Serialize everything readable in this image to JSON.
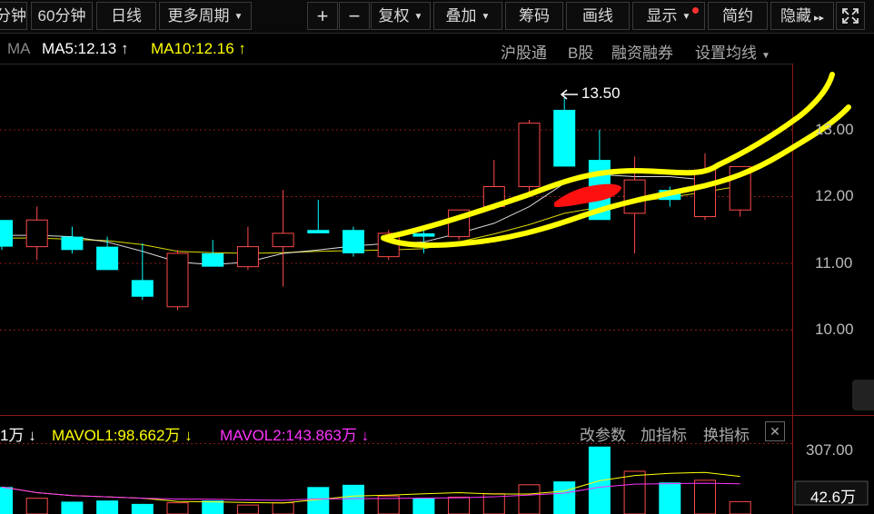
{
  "toolbar": {
    "left_items": [
      "分钟",
      "60分钟",
      "日线",
      "更多周期"
    ],
    "right_items": [
      "复权",
      "叠加",
      "筹码",
      "画线",
      "显示",
      "简约",
      "隐藏"
    ],
    "plus": "+",
    "minus": "−",
    "more_arrows": "▸▸"
  },
  "ma_bar": {
    "ma_label": "MA",
    "ma5": "MA5:12.13",
    "ma10": "MA10:12.16",
    "up_arrow": "↑",
    "links": [
      "沪股通",
      "B股",
      "融资融券",
      "设置均线"
    ]
  },
  "price_axis": [
    "13.00",
    "12.00",
    "11.00",
    "10.00"
  ],
  "max_annotation": "13.50",
  "vol_bar": {
    "vol_prefix": "1万",
    "mavol1": "MAVOL1:98.662万",
    "mavol2": "MAVOL2:143.863万",
    "down_arrow": "↓",
    "buttons": [
      "改参数",
      "加指标",
      "换指标"
    ],
    "close": "✕"
  },
  "vol_axis_top": "307.00",
  "vol_current": "42.6万",
  "colors": {
    "up": "#ff4a4a",
    "down": "#00ffff",
    "ma5": "#ffffff",
    "ma10": "#ffff00",
    "mavol2": "#ff33ff",
    "highlight": "#ffff00",
    "marker": "#ff0000"
  },
  "chart_data": {
    "type": "candlestick",
    "ylim": [
      9.0,
      14.0
    ],
    "candles": [
      {
        "o": 11.65,
        "h": 11.65,
        "l": 11.2,
        "c": 11.25
      },
      {
        "o": 11.25,
        "h": 11.85,
        "l": 11.05,
        "c": 11.65
      },
      {
        "o": 11.4,
        "h": 11.55,
        "l": 11.15,
        "c": 11.2
      },
      {
        "o": 11.25,
        "h": 11.4,
        "l": 10.9,
        "c": 10.9
      },
      {
        "o": 10.75,
        "h": 11.3,
        "l": 10.45,
        "c": 10.5
      },
      {
        "o": 10.35,
        "h": 11.2,
        "l": 10.3,
        "c": 11.15
      },
      {
        "o": 11.15,
        "h": 11.35,
        "l": 10.95,
        "c": 10.95
      },
      {
        "o": 10.95,
        "h": 11.55,
        "l": 10.9,
        "c": 11.25
      },
      {
        "o": 11.25,
        "h": 12.1,
        "l": 10.65,
        "c": 11.45
      },
      {
        "o": 11.5,
        "h": 11.95,
        "l": 11.45,
        "c": 11.45
      },
      {
        "o": 11.5,
        "h": 11.55,
        "l": 11.1,
        "c": 11.15
      },
      {
        "o": 11.1,
        "h": 11.5,
        "l": 11.05,
        "c": 11.45
      },
      {
        "o": 11.45,
        "h": 11.55,
        "l": 11.15,
        "c": 11.4
      },
      {
        "o": 11.4,
        "h": 11.8,
        "l": 11.35,
        "c": 11.8
      },
      {
        "o": 11.85,
        "h": 12.55,
        "l": 11.8,
        "c": 12.15
      },
      {
        "o": 12.15,
        "h": 13.15,
        "l": 12.05,
        "c": 13.1
      },
      {
        "o": 13.3,
        "h": 13.5,
        "l": 12.5,
        "c": 12.45
      },
      {
        "o": 12.55,
        "h": 13.0,
        "l": 11.95,
        "c": 11.65
      },
      {
        "o": 11.75,
        "h": 12.6,
        "l": 11.15,
        "c": 12.25
      },
      {
        "o": 12.1,
        "h": 12.15,
        "l": 11.85,
        "c": 11.95
      },
      {
        "o": 11.7,
        "h": 12.65,
        "l": 11.65,
        "c": 12.4
      },
      {
        "o": 11.8,
        "h": 12.45,
        "l": 11.7,
        "c": 12.45
      }
    ],
    "ma5": [
      11.42,
      11.42,
      11.4,
      11.32,
      11.18,
      11.02,
      10.98,
      11.02,
      11.15,
      11.2,
      11.26,
      11.3,
      11.32,
      11.45,
      11.6,
      11.85,
      12.2,
      12.33,
      12.3,
      12.3,
      12.25,
      12.22
    ],
    "ma10": [
      11.38,
      11.38,
      11.36,
      11.34,
      11.28,
      11.18,
      11.16,
      11.15,
      11.16,
      11.18,
      11.19,
      11.2,
      11.22,
      11.32,
      11.44,
      11.58,
      11.75,
      11.84,
      11.92,
      11.99,
      12.07,
      12.16
    ],
    "volumes": [
      120,
      70,
      55,
      60,
      45,
      50,
      60,
      40,
      50,
      120,
      130,
      80,
      70,
      75,
      90,
      130,
      145,
      300,
      190,
      140,
      150,
      55
    ],
    "volume_ylim": [
      0,
      307
    ]
  }
}
